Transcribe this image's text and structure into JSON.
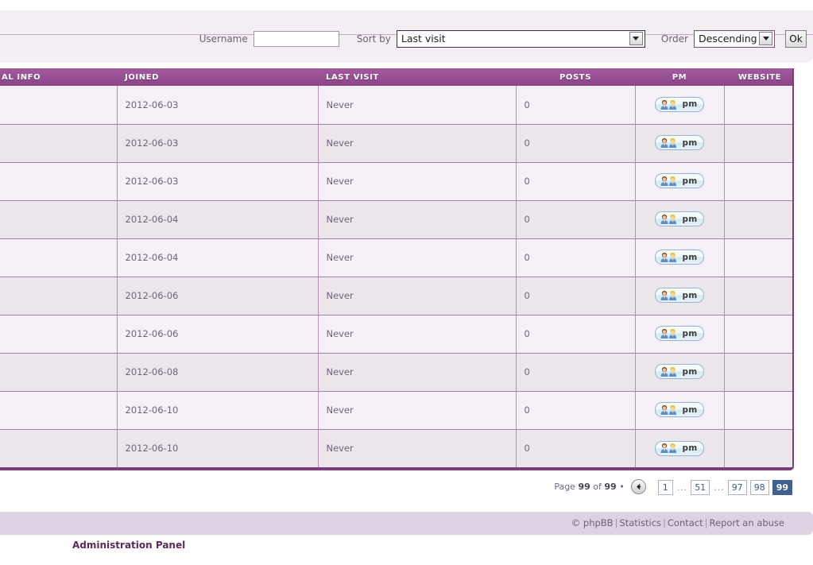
{
  "filters": {
    "username_label": "Username",
    "username_value": "",
    "username_placeholder": "",
    "sortby_label": "Sort by",
    "sortby_value": "Last visit",
    "sortby_options": [
      "Last visit"
    ],
    "order_label": "Order",
    "order_value": "Descending",
    "order_options": [
      "Descending"
    ],
    "ok_label": "Ok"
  },
  "table": {
    "columns": [
      {
        "key": "info",
        "label": "AL INFO",
        "align": "left"
      },
      {
        "key": "joined",
        "label": "JOINED",
        "align": "left"
      },
      {
        "key": "last",
        "label": "LAST VISIT",
        "align": "left"
      },
      {
        "key": "posts",
        "label": "POSTS",
        "align": "center"
      },
      {
        "key": "pm",
        "label": "PM",
        "align": "center"
      },
      {
        "key": "website",
        "label": "WEBSITE",
        "align": "center"
      }
    ],
    "pm_button_label": "pm",
    "rows": [
      {
        "info": "",
        "joined": "2012-06-03",
        "last": "Never",
        "posts": "0",
        "pm": "pm",
        "website": ""
      },
      {
        "info": "",
        "joined": "2012-06-03",
        "last": "Never",
        "posts": "0",
        "pm": "pm",
        "website": ""
      },
      {
        "info": "",
        "joined": "2012-06-03",
        "last": "Never",
        "posts": "0",
        "pm": "pm",
        "website": ""
      },
      {
        "info": "",
        "joined": "2012-06-04",
        "last": "Never",
        "posts": "0",
        "pm": "pm",
        "website": ""
      },
      {
        "info": "",
        "joined": "2012-06-04",
        "last": "Never",
        "posts": "0",
        "pm": "pm",
        "website": ""
      },
      {
        "info": "",
        "joined": "2012-06-06",
        "last": "Never",
        "posts": "0",
        "pm": "pm",
        "website": ""
      },
      {
        "info": "",
        "joined": "2012-06-06",
        "last": "Never",
        "posts": "0",
        "pm": "pm",
        "website": ""
      },
      {
        "info": "",
        "joined": "2012-06-08",
        "last": "Never",
        "posts": "0",
        "pm": "pm",
        "website": ""
      },
      {
        "info": "",
        "joined": "2012-06-10",
        "last": "Never",
        "posts": "0",
        "pm": "pm",
        "website": ""
      },
      {
        "info": "",
        "joined": "2012-06-10",
        "last": "Never",
        "posts": "0",
        "pm": "pm",
        "website": ""
      }
    ]
  },
  "pagination": {
    "page_prefix": "Page",
    "current_page": "99",
    "of_word": "of",
    "total_pages": "99",
    "bullet": "•",
    "prev_icon": "arrow-left-icon",
    "items": [
      {
        "label": "1",
        "active": false,
        "type": "page"
      },
      {
        "label": "...",
        "active": false,
        "type": "dots"
      },
      {
        "label": "51",
        "active": false,
        "type": "page"
      },
      {
        "label": "...",
        "active": false,
        "type": "dots"
      },
      {
        "label": "97",
        "active": false,
        "type": "page"
      },
      {
        "label": "98",
        "active": false,
        "type": "page"
      },
      {
        "label": "99",
        "active": true,
        "type": "page"
      }
    ]
  },
  "footer": {
    "copyright": "© phpBB",
    "links": [
      "Statistics",
      "Contact",
      "Report an abuse"
    ],
    "separator": "|",
    "admin_panel": "Administration Panel"
  },
  "colors": {
    "header_purple": "#8d4589",
    "panel_bg": "#f2eef4",
    "row_odd": "#f5eff7",
    "row_even": "#ebe6ec",
    "footer_bg": "#ded2e2",
    "active_page": "#3f6190",
    "admin_text": "#5c2a5a"
  }
}
